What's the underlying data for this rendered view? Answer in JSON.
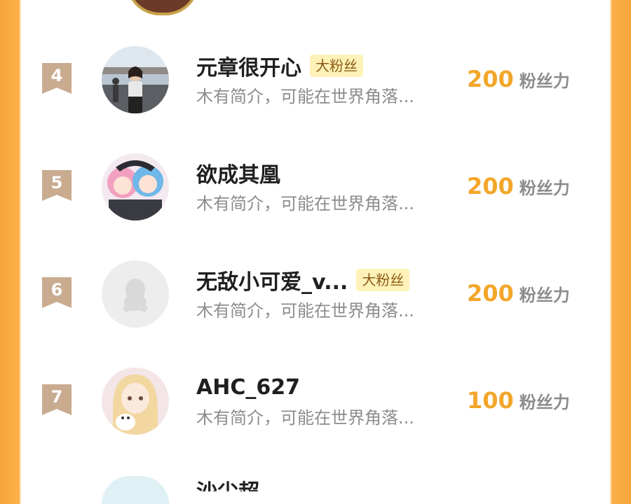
{
  "list": {
    "rows": [
      {
        "rank": "4",
        "name": "元章很开心",
        "badge": "大粉丝",
        "bio": "木有简介，可能在世界角落...",
        "score": "200",
        "unit": "粉丝力"
      },
      {
        "rank": "5",
        "name": "欲成其凰",
        "badge": "",
        "bio": "木有简介，可能在世界角落...",
        "score": "200",
        "unit": "粉丝力"
      },
      {
        "rank": "6",
        "name": "无敌小可爱_v...",
        "badge": "大粉丝",
        "bio": "木有简介，可能在世界角落...",
        "score": "200",
        "unit": "粉丝力"
      },
      {
        "rank": "7",
        "name": "AHC_627",
        "badge": "",
        "bio": "木有简介，可能在世界角落...",
        "score": "100",
        "unit": "粉丝力"
      }
    ],
    "next_name_partial": "沙尘超"
  },
  "colors": {
    "accent": "#f2a62a",
    "rank_badge": "#c9ab90",
    "fan_badge_bg": "#fff2b8",
    "side_bars": "#f7a53a"
  }
}
